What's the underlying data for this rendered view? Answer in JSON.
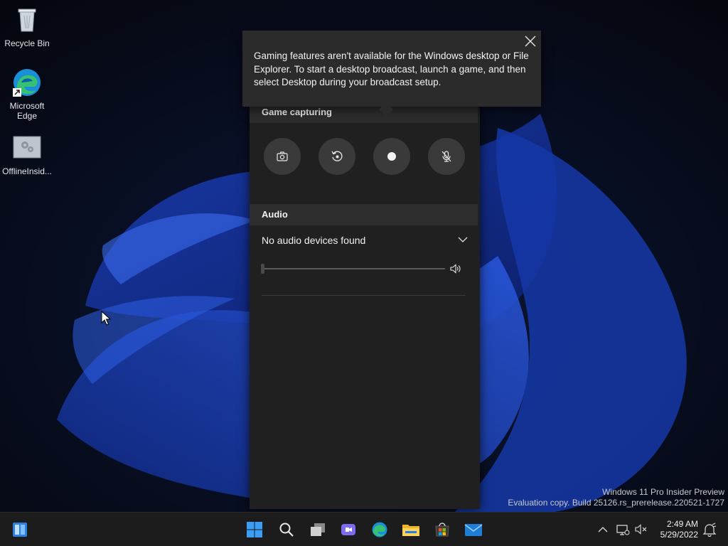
{
  "desktop": {
    "icons": [
      {
        "label": "Recycle Bin",
        "icon": "recycle-bin-icon"
      },
      {
        "label": "Microsoft Edge",
        "icon": "edge-icon"
      },
      {
        "label": "OfflineInsid...",
        "icon": "app-icon"
      }
    ]
  },
  "tooltip": {
    "message": "Gaming features aren't available for the Windows desktop or File Explorer. To start a desktop broadcast, launch a game, and then select Desktop during your broadcast setup.",
    "close_icon": "close-icon"
  },
  "gamebar": {
    "capture": {
      "header": "Game capturing",
      "buttons": [
        {
          "icon": "camera-icon"
        },
        {
          "icon": "record-last-icon"
        },
        {
          "icon": "record-dot-icon"
        },
        {
          "icon": "mic-off-icon"
        }
      ]
    },
    "audio": {
      "header": "Audio",
      "device_selected": "No audio devices found",
      "volume_icon": "volume-icon"
    }
  },
  "watermark": {
    "line1": "Windows 11 Pro Insider Preview",
    "line2": "Evaluation copy. Build 25126.rs_prerelease.220521-1727"
  },
  "taskbar": {
    "apps": [
      "start-icon",
      "search-icon",
      "task-view-icon",
      "chat-icon",
      "edge-icon",
      "file-explorer-icon",
      "store-icon",
      "mail-icon"
    ],
    "clock": {
      "time": "2:49 AM",
      "date": "5/29/2022"
    }
  },
  "colors": {
    "accent": "#2f6fd8",
    "panel": "#202020",
    "taskbar": "#1c1c1c"
  }
}
